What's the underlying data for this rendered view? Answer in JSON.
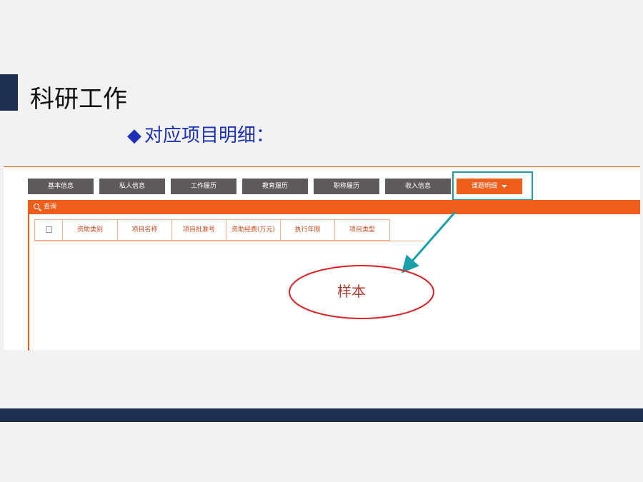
{
  "slide": {
    "title": "科研工作",
    "subtitle_marker": "◆",
    "subtitle": "对应项目明细："
  },
  "tabs": [
    {
      "label": "基本信息"
    },
    {
      "label": "私人信息"
    },
    {
      "label": "工作履历"
    },
    {
      "label": "教育履历"
    },
    {
      "label": "职称履历"
    },
    {
      "label": "收入信息"
    },
    {
      "label": "课题明细",
      "active": true
    }
  ],
  "query": {
    "label": "查询"
  },
  "table": {
    "columns": [
      "资助类别",
      "项目名称",
      "项目批准号",
      "资助经费(万元)",
      "执行年限",
      "项目类型"
    ]
  },
  "annotation": {
    "label": "样本"
  },
  "colors": {
    "accent": "#ef5d1b",
    "tab_default": "#5e5a5b",
    "title_bar": "#1f2f4f",
    "subtitle": "#1b2fb8",
    "highlight": "#1aa0a8",
    "ellipse": "#e02020"
  }
}
